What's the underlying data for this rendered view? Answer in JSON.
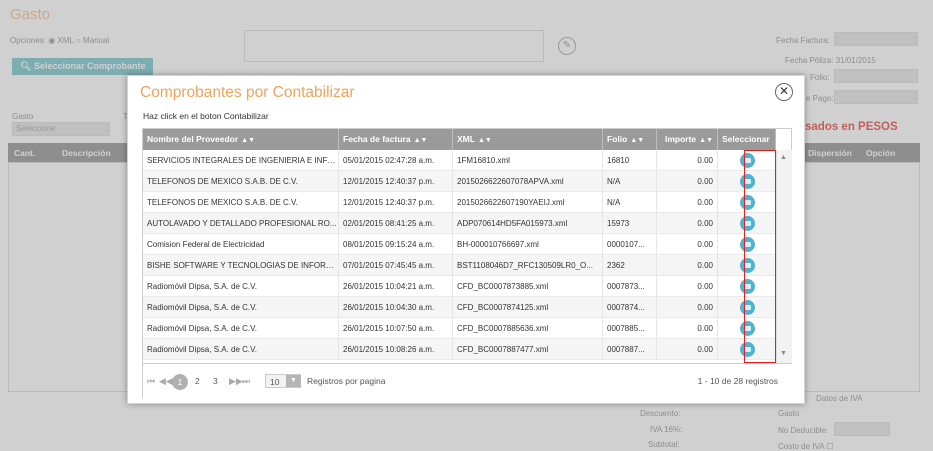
{
  "background": {
    "title": "Gasto",
    "options_label": "Opciones:",
    "option_xml": "XML",
    "option_manual": "Manual",
    "select_button": "Seleccionar Comprobante",
    "fecha_factura_label": "Fecha Factura:",
    "fecha_poliza": "Fecha Póliza: 31/01/2015",
    "folio_label": "Folio:",
    "fecha_pago_label": "e Pago:",
    "gasto_label": "Gasto",
    "gasto_placeholder": "Seleccione",
    "t_label": "T",
    "col_cant": "Cant.",
    "col_descripcion": "Descripción",
    "section_red": "sados en PESOS",
    "col_dispersion": "Dispersión",
    "col_opcion": "Opción",
    "descuento_label": "Descuento:",
    "iva_label": "IVA 16%:",
    "subtotal_label": "Subtotal:",
    "datos_iva": "Datos de IVA",
    "gasto2": "Gasto",
    "no_deducible": "No Deducible:",
    "costo_iva": "Costo de IVA",
    "fecha_tag": "Fecha"
  },
  "modal": {
    "title": "Comprobantes por Contabilizar",
    "subtitle": "Haz click en el boton Contabilizar",
    "columns": [
      "Nombre del Proveedor",
      "Fecha de factura",
      "XML",
      "Folio",
      "Importe",
      "Seleccionar"
    ],
    "rows": [
      [
        "SERVICIOS INTEGRALES DE INGENIERIA E INFO...",
        "05/01/2015 02:47:28 a.m.",
        "1FM16810.xml",
        "16810",
        "0.00"
      ],
      [
        "TELEFONOS DE MEXICO S.A.B. DE C.V.",
        "12/01/2015 12:40:37 p.m.",
        "2015026622607078APVA.xml",
        "N/A",
        "0.00"
      ],
      [
        "TELEFONOS DE MEXICO S.A.B. DE C.V.",
        "12/01/2015 12:40:37 p.m.",
        "2015026622607190YAEIJ.xml",
        "N/A",
        "0.00"
      ],
      [
        "AUTOLAVADO Y DETALLADO PROFESIONAL RO...",
        "02/01/2015 08:41:25 a.m.",
        "ADP070614HD5FA015973.xml",
        "15973",
        "0.00"
      ],
      [
        "Comision Federal de Electricidad",
        "08/01/2015 09:15:24 a.m.",
        "BH-000010766697.xml",
        "0000107...",
        "0.00"
      ],
      [
        "BISHE SOFTWARE Y TECNOLOGIAS DE INFORM...",
        "07/01/2015 07:45:45 a.m.",
        "BST1108046D7_RFC130509LR0_O...",
        "2362",
        "0.00"
      ],
      [
        "Radiomóvil Dipsa, S.A. de C.V.",
        "26/01/2015 10:04:21 a.m.",
        "CFD_BC0007873885.xml",
        "0007873...",
        "0.00"
      ],
      [
        "Radiomóvil Dipsa, S.A. de C.V.",
        "26/01/2015 10:04:30 a.m.",
        "CFD_BC0007874125.xml",
        "0007874...",
        "0.00"
      ],
      [
        "Radiomóvil Dipsa, S.A. de C.V.",
        "26/01/2015 10:07:50 a.m.",
        "CFD_BC0007885636.xml",
        "0007885...",
        "0.00"
      ],
      [
        "Radiomóvil Dipsa, S.A. de C.V.",
        "26/01/2015 10:08:26 a.m.",
        "CFD_BC0007887477.xml",
        "0007887...",
        "0.00"
      ]
    ],
    "pager": {
      "first": "⏮",
      "prev": "◀◀",
      "pages": [
        "1",
        "2",
        "3"
      ],
      "next": "▶▶",
      "last": "⏭",
      "page_size": "10",
      "per_page_label": "Registros por pagina",
      "summary": "1 - 10 de 28 registros"
    },
    "close_glyph": "✕"
  },
  "colors": {
    "accent_orange": "#f0a35a",
    "teal": "#7ecbd0",
    "select_icon": "#4fb2cf",
    "highlight_red": "#e02020"
  }
}
